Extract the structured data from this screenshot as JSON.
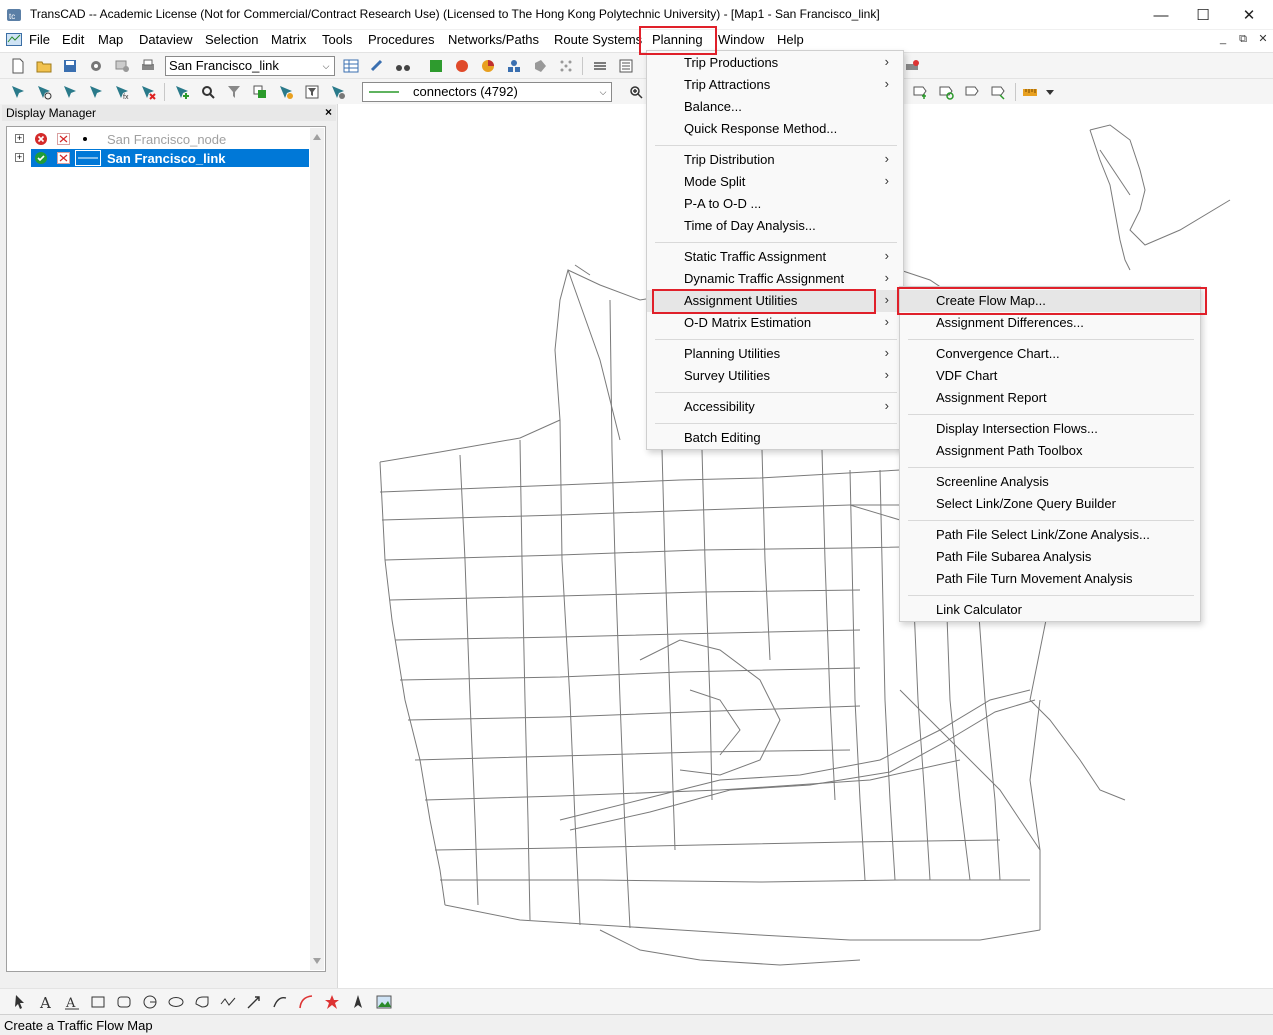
{
  "window": {
    "title": "TransCAD -- Academic License (Not for Commercial/Contract Research Use) (Licensed to The Hong Kong Polytechnic University) - [Map1 - San Francisco_link]",
    "app_icon": "transcad-icon",
    "controls": {
      "minimize": "—",
      "maximize": "☐",
      "close": "✕"
    }
  },
  "menubar": {
    "items": [
      "File",
      "Edit",
      "Map",
      "Dataview",
      "Selection",
      "Matrix",
      "Tools",
      "Procedures",
      "Networks/Paths",
      "Route Systems",
      "Planning",
      "Window",
      "Help"
    ],
    "active": "Planning",
    "mdi_controls": [
      "_",
      "⧉",
      "✕"
    ]
  },
  "toolbar1": {
    "layer_combo": "San Francisco_link"
  },
  "toolbar2": {
    "selection_combo": "connectors (4792)"
  },
  "display_manager": {
    "title": "Display Manager",
    "close": "×",
    "layers": [
      {
        "name": "San Francisco_node",
        "visible": false,
        "selected": false
      },
      {
        "name": "San Francisco_link",
        "visible": true,
        "selected": true
      }
    ]
  },
  "planning_menu": {
    "groups": [
      [
        {
          "label": "Trip Productions",
          "submenu": true
        },
        {
          "label": "Trip Attractions",
          "submenu": true
        },
        {
          "label": "Balance...",
          "submenu": false
        },
        {
          "label": "Quick Response Method...",
          "submenu": false
        }
      ],
      [
        {
          "label": "Trip Distribution",
          "submenu": true
        },
        {
          "label": "Mode Split",
          "submenu": true
        },
        {
          "label": "P-A to O-D ...",
          "submenu": false
        },
        {
          "label": "Time of Day Analysis...",
          "submenu": false
        }
      ],
      [
        {
          "label": "Static Traffic Assignment",
          "submenu": true
        },
        {
          "label": "Dynamic Traffic Assignment",
          "submenu": true
        },
        {
          "label": "Assignment Utilities",
          "submenu": true
        },
        {
          "label": "O-D Matrix Estimation",
          "submenu": true
        }
      ],
      [
        {
          "label": "Planning Utilities",
          "submenu": true
        },
        {
          "label": "Survey Utilities",
          "submenu": true
        }
      ],
      [
        {
          "label": "Accessibility",
          "submenu": true
        }
      ],
      [
        {
          "label": "Batch Editing",
          "submenu": false
        }
      ]
    ],
    "highlighted": "Assignment Utilities"
  },
  "assignment_utilities_menu": {
    "groups": [
      [
        "Create Flow Map...",
        "Assignment Differences..."
      ],
      [
        "Convergence Chart...",
        "VDF Chart",
        "Assignment Report"
      ],
      [
        "Display Intersection Flows...",
        "Assignment Path Toolbox"
      ],
      [
        "Screenline Analysis",
        "Select Link/Zone Query Builder"
      ],
      [
        "Path File Select Link/Zone Analysis...",
        "Path File Subarea Analysis",
        "Path File Turn Movement Analysis"
      ],
      [
        "Link Calculator"
      ]
    ],
    "highlighted": "Create Flow Map..."
  },
  "statusbar": {
    "text": "Create a Traffic Flow Map"
  },
  "colors": {
    "selection_blue": "#0078d7",
    "annotation_red": "#e0202a",
    "map_link_gray": "#7a7a7a"
  }
}
